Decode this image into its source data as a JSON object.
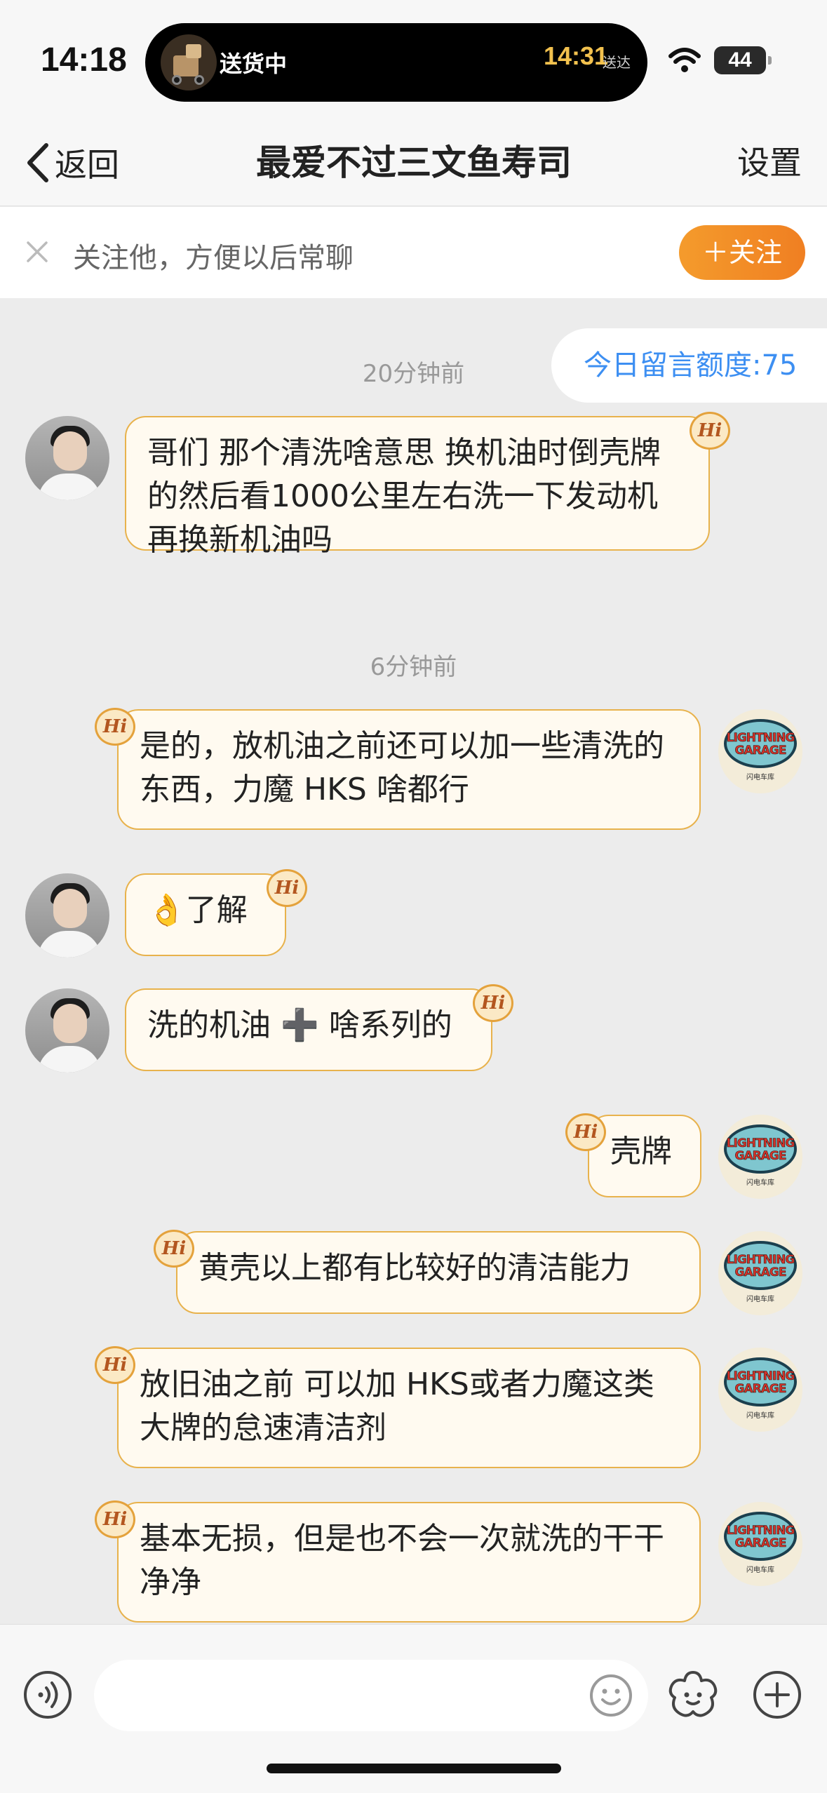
{
  "status_bar": {
    "time": "14:18",
    "island_status": "送货中",
    "island_eta": "14:31",
    "island_eta_label": "送达",
    "battery": "44"
  },
  "nav": {
    "back_label": "返回",
    "title": "最爱不过三文鱼寿司",
    "settings_label": "设置"
  },
  "follow_banner": {
    "hint": "关注他，方便以后常聊",
    "button_label": "＋关注"
  },
  "chat": {
    "quota": "今日留言额度:75",
    "timestamps": [
      "20分钟前",
      "6分钟前"
    ],
    "messages": [
      {
        "sender": "other",
        "text": "哥们 那个清洗啥意思 换机油时倒壳牌的然后看1000公里左右洗一下发动机再换新机油吗"
      },
      {
        "sender": "self",
        "text": "是的，放机油之前还可以加一些清洗的东西，力魔 HKS 啥都行"
      },
      {
        "sender": "other",
        "text": "👌了解"
      },
      {
        "sender": "other",
        "text": "洗的机油 ➕ 啥系列的"
      },
      {
        "sender": "self",
        "text": "壳牌"
      },
      {
        "sender": "self",
        "text": "黄壳以上都有比较好的清洁能力"
      },
      {
        "sender": "self",
        "text": "放旧油之前 可以加 HKS或者力魔这类大牌的怠速清洁剂"
      },
      {
        "sender": "self",
        "text": "基本无损，但是也不会一次就洗的干干净净"
      }
    ],
    "badge_text": "Hi",
    "garage_logo": "LIGHTNING GARAGE",
    "garage_sub": "闪电车库"
  },
  "input_bar": {
    "placeholder": ""
  },
  "colors": {
    "accent_orange": "#f07f22",
    "link_blue": "#3d8ff2",
    "bubble_border": "#e8b24c",
    "bubble_fill": "#fffaf0"
  }
}
